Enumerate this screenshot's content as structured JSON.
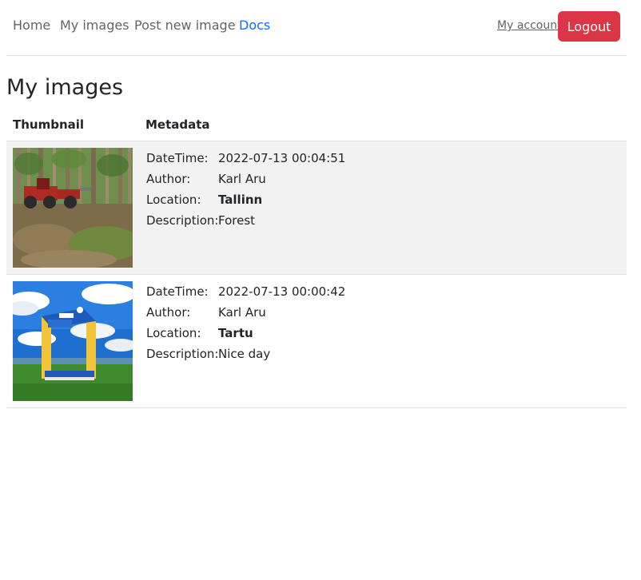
{
  "nav": {
    "home": "Home",
    "my_images": "My images",
    "post_new_image": "Post new image",
    "docs": "Docs",
    "my_account": "My account",
    "logout": "Logout"
  },
  "colors": {
    "active_link": "#0d6efd",
    "logout_button": "#dc3545",
    "stripe": "#f2f2f2"
  },
  "page": {
    "title": "My images"
  },
  "table": {
    "headers": {
      "thumbnail": "Thumbnail",
      "metadata": "Metadata"
    },
    "labels": {
      "datetime": "DateTime:",
      "author": "Author:",
      "location": "Location:",
      "description": "Description:"
    },
    "rows": [
      {
        "datetime": "2022-07-13 00:04:51",
        "author": "Karl Aru",
        "location": "Tallinn",
        "description": "Forest",
        "thumbnail_icon": "forest-harvester-photo"
      },
      {
        "datetime": "2022-07-13 00:00:42",
        "author": "Karl Aru",
        "location": "Tartu",
        "description": "Nice day",
        "thumbnail_icon": "sky-sign-photo"
      }
    ]
  }
}
